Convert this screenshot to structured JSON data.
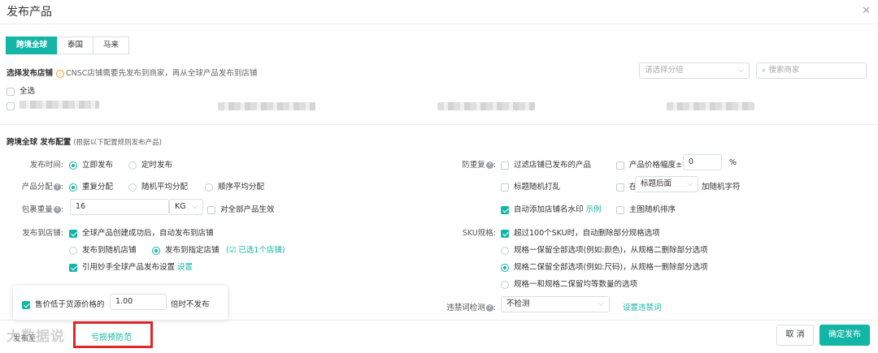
{
  "dialog": {
    "title": "发布产品",
    "close_icon": "close-icon"
  },
  "tabs": [
    {
      "label": "跨境全球",
      "active": true
    },
    {
      "label": "泰国",
      "active": false
    },
    {
      "label": "马来",
      "active": false
    }
  ],
  "stores": {
    "heading": "选择发布店铺",
    "hint": "CNSC店铺需要先发布到商家，再从全球产品发布到店铺",
    "group_placeholder": "请选择分组",
    "search_placeholder": "搜索商家",
    "select_all": "全选"
  },
  "config": {
    "heading": "跨境全球 发布配置",
    "sub": "(根据以下配置规则发布产品)"
  },
  "left": {
    "publish_time": {
      "label": "发布时间:",
      "options": [
        "立即发布",
        "定时发布"
      ]
    },
    "allocation": {
      "label": "产品分配",
      "options": [
        "重复分配",
        "随机平均分配",
        "顺序平均分配"
      ]
    },
    "weight": {
      "label": "包裹重量",
      "value": "16",
      "unit": "KG",
      "apply_all": "对全部产品生效"
    },
    "to_store": {
      "label": "发布到店铺:",
      "auto": "全球产品创建成功后，自动发布到店铺",
      "random": "发布到随机店铺",
      "specified": "发布到指定店铺",
      "selected": "已选1个店铺",
      "reference": "引用妙手全球产品发布设置",
      "settings": "设置"
    }
  },
  "right": {
    "anti_dup": {
      "label": "防重复",
      "filter": "过滤店铺已发布的产品",
      "price_range": "产品价格幅度±",
      "price_value": "0",
      "pct": "%"
    },
    "title_shuffle": {
      "label": "标题随机打乱",
      "at": "在",
      "position": "标题后面",
      "add": "加随机字符"
    },
    "watermark": {
      "label": "自动添加店铺名水印",
      "example": "示例",
      "random_main": "主图随机排序"
    },
    "sku": {
      "label": "SKU规格:",
      "auto_delete": "超过100个SKU时，自动删除部分规格选项",
      "opt1": "规格一保留全部选项(例如:颜色)，从规格二删除部分选项",
      "opt2": "规格二保留全部选项(例如:尺码)，从规格一删除部分选项",
      "opt3": "规格一和规格二保留均等数量的选项"
    },
    "banned": {
      "label": "违禁词检测",
      "value": "不检测",
      "settings": "设置违禁词"
    }
  },
  "popup": {
    "text1": "售价低于货源价格的",
    "value": "1.00",
    "text2": "倍时不发布"
  },
  "footer": {
    "left_text": "发布至",
    "risk": "亏损预防范",
    "watermark": "大数据说",
    "cancel": "取 消",
    "confirm": "确定发布"
  },
  "colors": {
    "accent": "#13b5a7",
    "highlight": "#e02828"
  }
}
